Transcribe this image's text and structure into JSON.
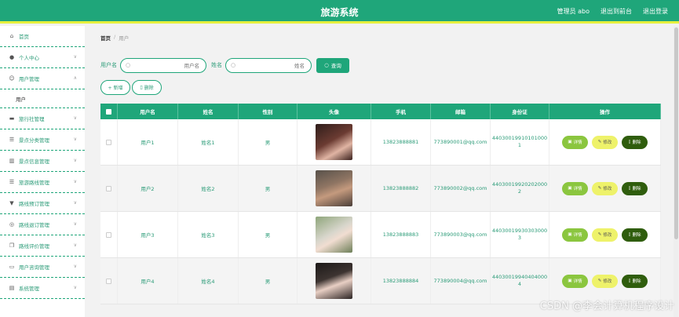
{
  "header": {
    "title": "旅游系统",
    "admin_label": "管理员 abo",
    "front_label": "退出到前台",
    "logout_label": "退出登录"
  },
  "sidebar": {
    "items": [
      {
        "label": "首页",
        "icon": "home-icon"
      },
      {
        "label": "个人中心",
        "icon": "person-icon"
      },
      {
        "label": "用户管理",
        "icon": "user-icon"
      },
      {
        "label": "用户",
        "icon": ""
      },
      {
        "label": "旅行社管理",
        "icon": "bus-icon"
      },
      {
        "label": "景点分类管理",
        "icon": "list-icon"
      },
      {
        "label": "景点信息管理",
        "icon": "chart-icon"
      },
      {
        "label": "旅游路线管理",
        "icon": "list-icon"
      },
      {
        "label": "路线预订管理",
        "icon": "cup-icon"
      },
      {
        "label": "路线退订管理",
        "icon": "dashboard-icon"
      },
      {
        "label": "路线评价管理",
        "icon": "copy-icon"
      },
      {
        "label": "用户咨询管理",
        "icon": "monitor-icon"
      },
      {
        "label": "系统管理",
        "icon": "message-icon"
      }
    ]
  },
  "breadcrumb": {
    "home": "首页",
    "sep": "/",
    "current": "用户"
  },
  "search": {
    "username_label": "用户名",
    "username_placeholder": "用户名",
    "name_label": "姓名",
    "name_placeholder": "姓名",
    "query_label": "查询"
  },
  "actions": {
    "add_label": "+ 新增",
    "delete_label": "删除"
  },
  "table": {
    "headers": [
      "用户名",
      "姓名",
      "性别",
      "头像",
      "手机",
      "邮箱",
      "身份证",
      "操作"
    ],
    "rows": [
      {
        "username": "用户1",
        "name": "姓名1",
        "gender": "男",
        "phone": "13823888881",
        "email": "773890001@qq.com",
        "idcard": "440300199101010001"
      },
      {
        "username": "用户2",
        "name": "姓名2",
        "gender": "男",
        "phone": "13823888882",
        "email": "773890002@qq.com",
        "idcard": "440300199202020002"
      },
      {
        "username": "用户3",
        "name": "姓名3",
        "gender": "男",
        "phone": "13823888883",
        "email": "773890003@qq.com",
        "idcard": "440300199303030003"
      },
      {
        "username": "用户4",
        "name": "姓名4",
        "gender": "男",
        "phone": "13823888884",
        "email": "773890004@qq.com",
        "idcard": "440300199404040004"
      }
    ],
    "op_detail": "详情",
    "op_edit": "修改",
    "op_delete": "删除"
  },
  "watermark": "CSDN @李会计算机程序设计",
  "colors": {
    "primary": "#1fa67a",
    "accent": "#e6f03d",
    "detail": "#8bc63f",
    "edit": "#eef26a",
    "delete": "#2f5d0d"
  }
}
